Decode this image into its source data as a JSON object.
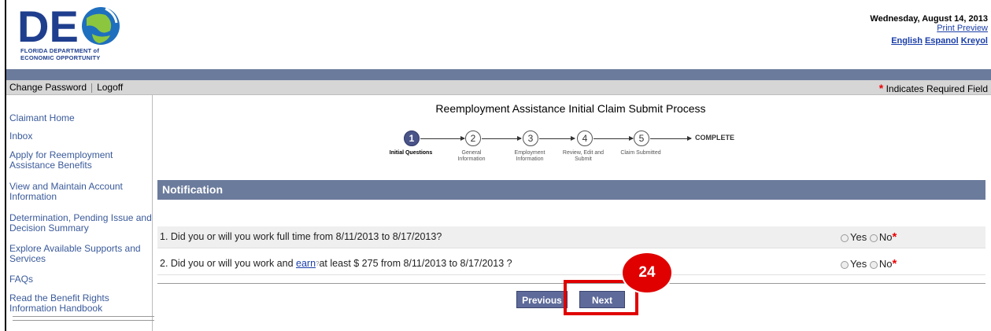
{
  "header": {
    "logo_text_top": "FLORIDA DEPARTMENT of",
    "logo_text_bottom": "ECONOMIC OPPORTUNITY",
    "date": "Wednesday, August 14, 2013",
    "print_preview": "Print Preview",
    "languages": [
      "English",
      "Espanol",
      "Kreyol"
    ]
  },
  "menubar": {
    "change_password": "Change Password",
    "logoff": "Logoff",
    "required_star": "*",
    "required_text": " Indicates Required Field"
  },
  "sidebar": {
    "items": [
      "Claimant Home",
      "Inbox",
      "Apply for Reemployment Assistance Benefits",
      "View and Maintain Account Information",
      "Determination, Pending Issue and Decision Summary",
      "Explore Available Supports and Services",
      "FAQs",
      "Read the Benefit Rights Information Handbook"
    ]
  },
  "main": {
    "title": "Reemployment Assistance Initial Claim Submit Process",
    "steps": [
      {
        "num": "1",
        "label": "Initial Questions"
      },
      {
        "num": "2",
        "label": "General Information"
      },
      {
        "num": "3",
        "label": "Employment Information"
      },
      {
        "num": "4",
        "label": "Review, Edit and Submit"
      },
      {
        "num": "5",
        "label": "Claim Submitted"
      }
    ],
    "complete": "COMPLETE",
    "notification": "Notification",
    "questions": [
      {
        "prefix": "1. Did you or will you work full time from 8/11/2013 to 8/17/2013?",
        "link": "",
        "suffix": ""
      },
      {
        "prefix": "2. Did you or will you work and ",
        "link": "earn",
        "suffix": "at least $ 275 from 8/11/2013 to 8/17/2013 ?"
      }
    ],
    "yes_label": "Yes",
    "no_label": "No",
    "previous_button": "Previous",
    "next_button": "Next",
    "annotation_badge": "24"
  },
  "colors": {
    "band": "#6b7b9c",
    "highlight": "#e00000",
    "link": "#1a3ea8"
  }
}
